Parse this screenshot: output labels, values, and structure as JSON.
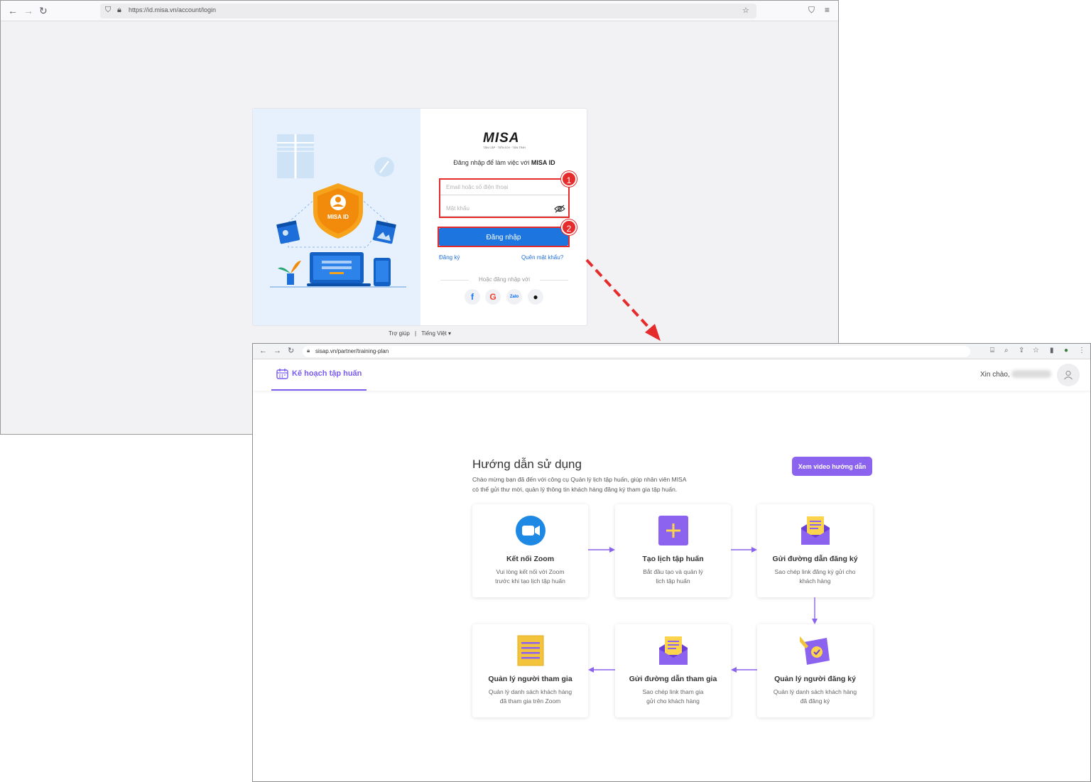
{
  "login_window": {
    "url": "https://id.misa.vn/account/login",
    "logo": "MISA",
    "slogan": "TẬN CẬP · TIỆN ÍCH · TẬN TÌNH",
    "shield_label": "MISA ID",
    "title_prefix": "Đăng nhập để làm việc với",
    "title_brand": "MISA ID",
    "email_placeholder": "Email hoặc số điện thoại",
    "password_placeholder": "Mật khẩu",
    "login_button": "Đăng nhập",
    "register_link": "Đăng ký",
    "forgot_link": "Quên mật khẩu?",
    "or_text": "Hoặc đăng nhập với",
    "social": [
      "facebook-icon",
      "google-icon",
      "zalo-icon",
      "apple-icon"
    ],
    "zalo_label": "Zalo",
    "footer_help": "Trợ giúp",
    "footer_sep": "|",
    "footer_lang": "Tiếng Việt ▾",
    "step_badges": [
      "1",
      "2"
    ]
  },
  "app_window": {
    "url": "sisap.vn/partner/training-plan",
    "tab_label": "Kế hoạch tập huấn",
    "greeting": "Xin chào,",
    "guide": {
      "title": "Hướng dẫn sử dụng",
      "desc_line1": "Chào mừng bạn đã đến với công cụ Quản lý lịch tập huấn, giúp nhân viên MISA",
      "desc_line2": "có thể gửi thư mời, quản lý thông tin khách hàng đăng ký tham gia tập huấn.",
      "video_button": "Xem video hướng dẫn"
    },
    "steps": [
      {
        "title": "Kết nối Zoom",
        "desc1": "Vui lòng kết nối với Zoom",
        "desc2": "trước khi tạo lịch tập huấn"
      },
      {
        "title": "Tạo lịch tập huấn",
        "desc1": "Bắt đầu tạo và quản lý",
        "desc2": "lịch tập huấn"
      },
      {
        "title": "Gửi đường dẫn đăng ký",
        "desc1": "Sao chép link đăng ký gửi cho",
        "desc2": "khách hàng"
      },
      {
        "title": "Quản lý người tham gia",
        "desc1": "Quản lý danh sách khách hàng",
        "desc2": "đã tham gia trên Zoom"
      },
      {
        "title": "Gửi đường dẫn tham gia",
        "desc1": "Sao chép link tham gia",
        "desc2": "gửi cho khách hàng"
      },
      {
        "title": "Quản lý người đăng ký",
        "desc1": "Quản lý danh sách khách hàng",
        "desc2": "đã đăng ký"
      }
    ]
  },
  "colors": {
    "login_blue": "#1d76e0",
    "highlight_red": "#e52b2b",
    "accent_purple": "#7b5cf0",
    "zoom_blue": "#1e88e5"
  }
}
